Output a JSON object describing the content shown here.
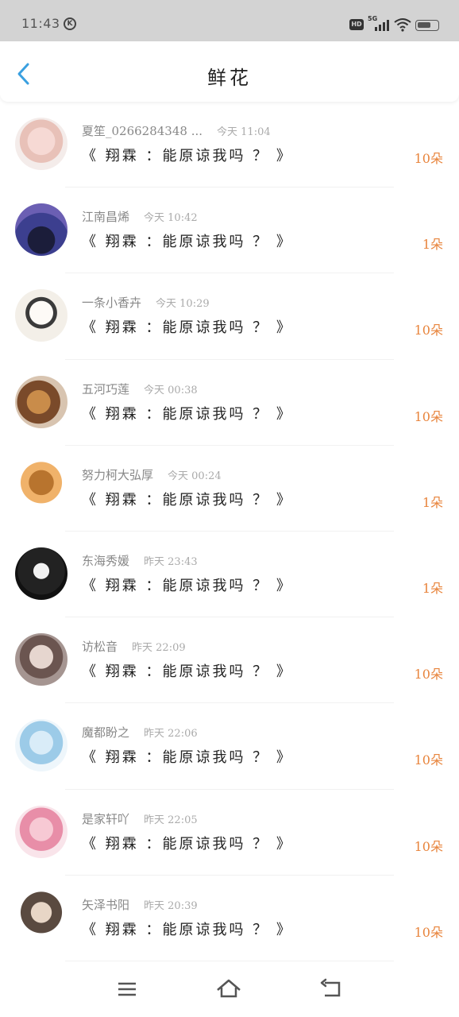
{
  "status_bar": {
    "time": "11:43",
    "k_badge": "K",
    "hd": "HD",
    "network": "5G",
    "battery_level": 0.7
  },
  "header": {
    "title": "鲜花",
    "back_icon": "chevron-left-icon",
    "accent_color": "#3aa0e0"
  },
  "list": {
    "count_color": "#e8843c",
    "items": [
      {
        "name": "夏笙_0266284348 ...",
        "time": "今天 11:04",
        "message": "《 翔霖 ：能原谅我吗 ？ 》",
        "count": "10朵"
      },
      {
        "name": "江南昌烯",
        "time": "今天 10:42",
        "message": "《 翔霖 ：能原谅我吗 ？ 》",
        "count": "1朵"
      },
      {
        "name": "一条小香卉",
        "time": "今天 10:29",
        "message": "《 翔霖 ：能原谅我吗 ？ 》",
        "count": "10朵"
      },
      {
        "name": "五河巧莲",
        "time": "今天 00:38",
        "message": "《 翔霖 ：能原谅我吗 ？ 》",
        "count": "10朵"
      },
      {
        "name": "努力柯大弘厚",
        "time": "今天 00:24",
        "message": "《 翔霖 ：能原谅我吗 ？ 》",
        "count": "1朵"
      },
      {
        "name": "东海秀媛",
        "time": "昨天 23:43",
        "message": "《 翔霖 ：能原谅我吗 ？ 》",
        "count": "1朵"
      },
      {
        "name": "访松音",
        "time": "昨天 22:09",
        "message": "《 翔霖 ：能原谅我吗 ？ 》",
        "count": "10朵"
      },
      {
        "name": "魔都盼之",
        "time": "昨天 22:06",
        "message": "《 翔霖 ：能原谅我吗 ？ 》",
        "count": "10朵"
      },
      {
        "name": "是家轩吖",
        "time": "昨天 22:05",
        "message": "《 翔霖 ：能原谅我吗 ？ 》",
        "count": "10朵"
      },
      {
        "name": "矢泽书阳",
        "time": "昨天 20:39",
        "message": "《 翔霖 ：能原谅我吗 ？ 》",
        "count": "10朵"
      }
    ]
  },
  "nav_bar": {
    "menu_icon": "menu-icon",
    "home_icon": "home-icon",
    "back_icon": "back-arrow-icon"
  }
}
